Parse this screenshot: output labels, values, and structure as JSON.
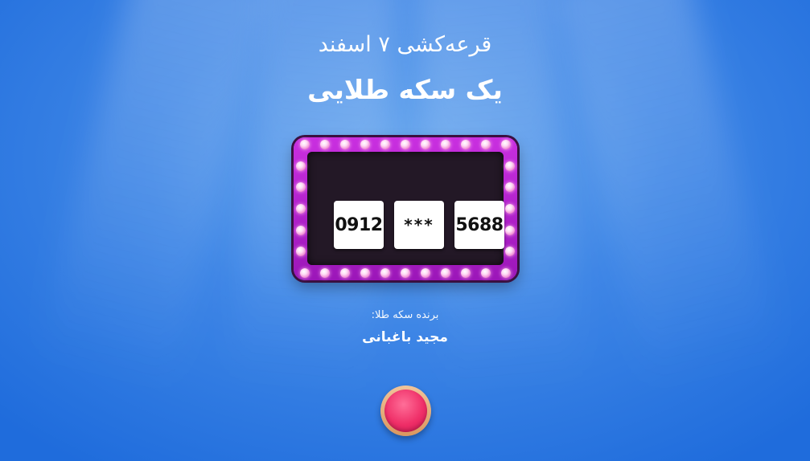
{
  "event": {
    "title": "قرعه‌کشی ۷ اسفند"
  },
  "prize": {
    "title": "یک سکه طلایی"
  },
  "draw": {
    "digits": [
      "0912",
      "***",
      "5688"
    ]
  },
  "winner": {
    "label": "برنده سکه طلا:",
    "name": "مجید باغبانی"
  },
  "colors": {
    "background": "#3e86e6",
    "frame": "#b21fcc",
    "bulb": "#f7b6e6",
    "button": "#ef2f68",
    "button_ring": "#e6ad7c"
  },
  "icons": {
    "button": "round-draw-button"
  }
}
